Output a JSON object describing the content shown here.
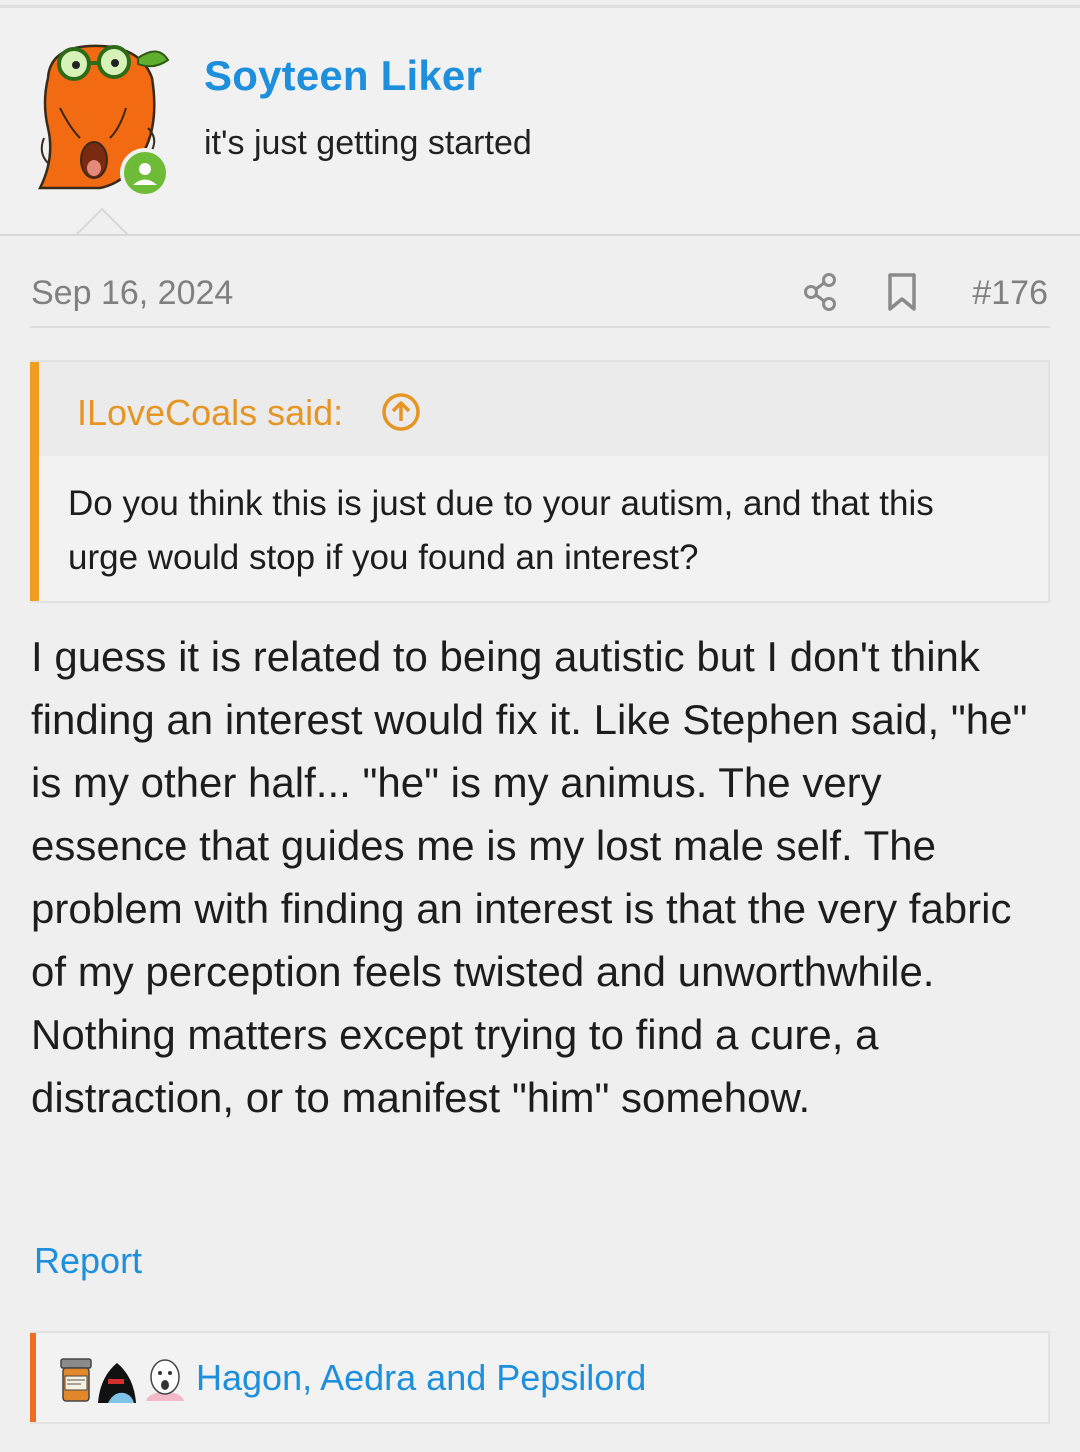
{
  "user": {
    "name": "Soyteen Liker",
    "title": "it's just getting started",
    "online_color": "#6dbb36"
  },
  "post": {
    "date": "Sep 16, 2024",
    "number": "#176",
    "body": "I guess it is related to being autistic but I don't think finding an interest would fix it. Like Stephen said, \"he\" is my other half... \"he\" is my animus. The very essence that guides me is my lost male self. The problem with finding an interest is that the very fabric of my perception feels twisted and unworthwhile. Nothing matters except trying to find a cure, a distraction, or to manifest \"him\" somehow."
  },
  "quote": {
    "author": "ILoveCoals said:",
    "text": "Do you think this is just due to your autism, and that this urge would stop if you found an interest?",
    "accent_color": "#f09d24"
  },
  "actions": {
    "share_icon": "share-icon",
    "bookmark_icon": "bookmark-icon",
    "report_label": "Report"
  },
  "reactions": {
    "users": "Hagon, Aedra and Pepsilord",
    "accent_color": "#ef6c23"
  },
  "colors": {
    "link": "#1e8fdc",
    "background": "#efefef"
  }
}
